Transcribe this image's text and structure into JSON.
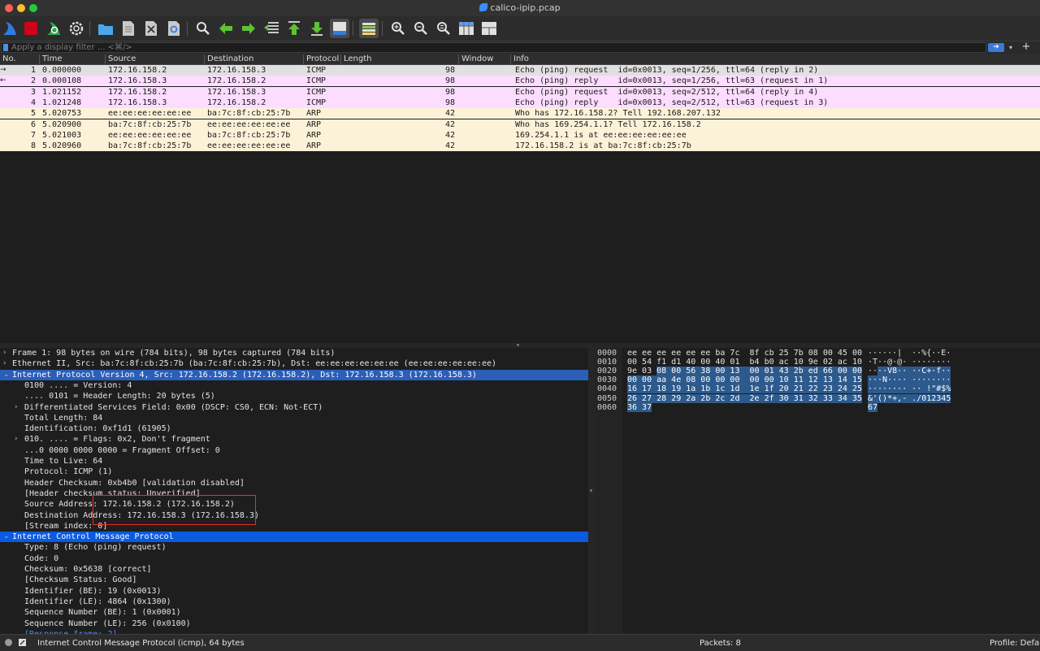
{
  "window": {
    "title": "calico-ipip.pcap"
  },
  "filter": {
    "placeholder": "Apply a display filter ... <⌘/>"
  },
  "columns": [
    "No.",
    "Time",
    "Source",
    "Destination",
    "Protocol",
    "Length",
    "Window",
    "Info"
  ],
  "packets": [
    {
      "no": "1",
      "time": "0.000000",
      "src": "172.16.158.2",
      "dst": "172.16.158.3",
      "proto": "ICMP",
      "len": "98",
      "info": "Echo (ping) request  id=0x0013, seq=1/256, ttl=64 (reply in 2)"
    },
    {
      "no": "2",
      "time": "0.000108",
      "src": "172.16.158.3",
      "dst": "172.16.158.2",
      "proto": "ICMP",
      "len": "98",
      "info": "Echo (ping) reply    id=0x0013, seq=1/256, ttl=63 (request in 1)"
    },
    {
      "no": "3",
      "time": "1.021152",
      "src": "172.16.158.2",
      "dst": "172.16.158.3",
      "proto": "ICMP",
      "len": "98",
      "info": "Echo (ping) request  id=0x0013, seq=2/512, ttl=64 (reply in 4)"
    },
    {
      "no": "4",
      "time": "1.021248",
      "src": "172.16.158.3",
      "dst": "172.16.158.2",
      "proto": "ICMP",
      "len": "98",
      "info": "Echo (ping) reply    id=0x0013, seq=2/512, ttl=63 (request in 3)"
    },
    {
      "no": "5",
      "time": "5.020753",
      "src": "ee:ee:ee:ee:ee:ee",
      "dst": "ba:7c:8f:cb:25:7b",
      "proto": "ARP",
      "len": "42",
      "info": "Who has 172.16.158.2? Tell 192.168.207.132"
    },
    {
      "no": "6",
      "time": "5.020900",
      "src": "ba:7c:8f:cb:25:7b",
      "dst": "ee:ee:ee:ee:ee:ee",
      "proto": "ARP",
      "len": "42",
      "info": "Who has 169.254.1.1? Tell 172.16.158.2"
    },
    {
      "no": "7",
      "time": "5.021003",
      "src": "ee:ee:ee:ee:ee:ee",
      "dst": "ba:7c:8f:cb:25:7b",
      "proto": "ARP",
      "len": "42",
      "info": "169.254.1.1 is at ee:ee:ee:ee:ee:ee"
    },
    {
      "no": "8",
      "time": "5.020960",
      "src": "ba:7c:8f:cb:25:7b",
      "dst": "ee:ee:ee:ee:ee:ee",
      "proto": "ARP",
      "len": "42",
      "info": "172.16.158.2 is at ba:7c:8f:cb:25:7b"
    }
  ],
  "details": [
    {
      "twisty": ">",
      "text": "Frame 1: 98 bytes on wire (784 bits), 98 bytes captured (784 bits)"
    },
    {
      "twisty": ">",
      "text": "Ethernet II, Src: ba:7c:8f:cb:25:7b (ba:7c:8f:cb:25:7b), Dst: ee:ee:ee:ee:ee:ee (ee:ee:ee:ee:ee:ee)"
    },
    {
      "twisty": "v",
      "text": "Internet Protocol Version 4, Src: 172.16.158.2 (172.16.158.2), Dst: 172.16.158.3 (172.16.158.3)"
    },
    {
      "twisty": "",
      "text": "0100 .... = Version: 4"
    },
    {
      "twisty": "",
      "text": ".... 0101 = Header Length: 20 bytes (5)"
    },
    {
      "twisty": ">",
      "text": "Differentiated Services Field: 0x00 (DSCP: CS0, ECN: Not-ECT)"
    },
    {
      "twisty": "",
      "text": "Total Length: 84"
    },
    {
      "twisty": "",
      "text": "Identification: 0xf1d1 (61905)"
    },
    {
      "twisty": ">",
      "text": "010. .... = Flags: 0x2, Don't fragment"
    },
    {
      "twisty": "",
      "text": "...0 0000 0000 0000 = Fragment Offset: 0"
    },
    {
      "twisty": "",
      "text": "Time to Live: 64"
    },
    {
      "twisty": "",
      "text": "Protocol: ICMP (1)"
    },
    {
      "twisty": "",
      "text": "Header Checksum: 0xb4b0 [validation disabled]"
    },
    {
      "twisty": "",
      "text": "[Header checksum status: Unverified]"
    },
    {
      "twisty": "",
      "text": "Source Address: 172.16.158.2 (172.16.158.2)"
    },
    {
      "twisty": "",
      "text": "Destination Address: 172.16.158.3 (172.16.158.3)"
    },
    {
      "twisty": "",
      "text": "[Stream index: 0]"
    },
    {
      "twisty": "v",
      "text": "Internet Control Message Protocol"
    },
    {
      "twisty": "",
      "text": "Type: 8 (Echo (ping) request)"
    },
    {
      "twisty": "",
      "text": "Code: 0"
    },
    {
      "twisty": "",
      "text": "Checksum: 0x5638 [correct]"
    },
    {
      "twisty": "",
      "text": "[Checksum Status: Good]"
    },
    {
      "twisty": "",
      "text": "Identifier (BE): 19 (0x0013)"
    },
    {
      "twisty": "",
      "text": "Identifier (LE): 4864 (0x1300)"
    },
    {
      "twisty": "",
      "text": "Sequence Number (BE): 1 (0x0001)"
    },
    {
      "twisty": "",
      "text": "Sequence Number (LE): 256 (0x0100)"
    },
    {
      "twisty": "",
      "text": "[Response frame: 2]"
    }
  ],
  "bytes": [
    {
      "off": "0000",
      "hex_a": "ee ee ee ee ee ee ba 7c  8f cb 25 7b 08 00 45 00",
      "hex_b": "",
      "asc_a": "······|  ··%{··E·",
      "asc_b": ""
    },
    {
      "off": "0010",
      "hex_a": "00 54 f1 d1 40 00 40 01  b4 b0 ac 10 9e 02 ac 10",
      "hex_b": "",
      "asc_a": "·T··@·@· ········",
      "asc_b": ""
    },
    {
      "off": "0020",
      "hex_a": "9e 03 ",
      "hex_b": "08 00 56 38 00 13  00 01 43 2b ed 66 00 00",
      "asc_a": "··",
      "asc_b": "··V8·· ··C+·f··"
    },
    {
      "off": "0030",
      "hex_a": "",
      "hex_b": "00 00 aa 4e 08 00 00 00  00 00 10 11 12 13 14 15",
      "asc_a": "",
      "asc_b": "···N···· ········"
    },
    {
      "off": "0040",
      "hex_a": "",
      "hex_b": "16 17 18 19 1a 1b 1c 1d  1e 1f 20 21 22 23 24 25",
      "asc_a": "",
      "asc_b": "········ ·· !\"#$%"
    },
    {
      "off": "0050",
      "hex_a": "",
      "hex_b": "26 27 28 29 2a 2b 2c 2d  2e 2f 30 31 32 33 34 35",
      "asc_a": "",
      "asc_b": "&'()*+,- ./012345"
    },
    {
      "off": "0060",
      "hex_a": "",
      "hex_b": "36 37",
      "asc_a": "",
      "asc_b": "67"
    }
  ],
  "status": {
    "protocol_info": "Internet Control Message Protocol (icmp), 64 bytes",
    "packets": "Packets: 8",
    "profile": "Profile: Default"
  },
  "colors": {
    "icmp_row": "#fcdcff",
    "arp_row": "#fcf2d8",
    "selected_tree": "#2b5eb8",
    "highlight_box": "#e8321e"
  },
  "toolbar": {
    "buttons": [
      "shark-fin-start-icon",
      "stop-capture-icon",
      "restart-capture-icon",
      "capture-options-icon",
      "open-file-icon",
      "save-file-icon",
      "close-file-icon",
      "reload-file-icon",
      "find-packet-icon",
      "go-back-icon",
      "go-forward-icon",
      "go-to-packet-icon",
      "first-packet-icon",
      "last-packet-icon",
      "autoscroll-icon",
      "colorize-icon",
      "zoom-in-icon",
      "zoom-out-icon",
      "zoom-normal-icon",
      "resize-columns-icon",
      "layout-icon"
    ]
  }
}
